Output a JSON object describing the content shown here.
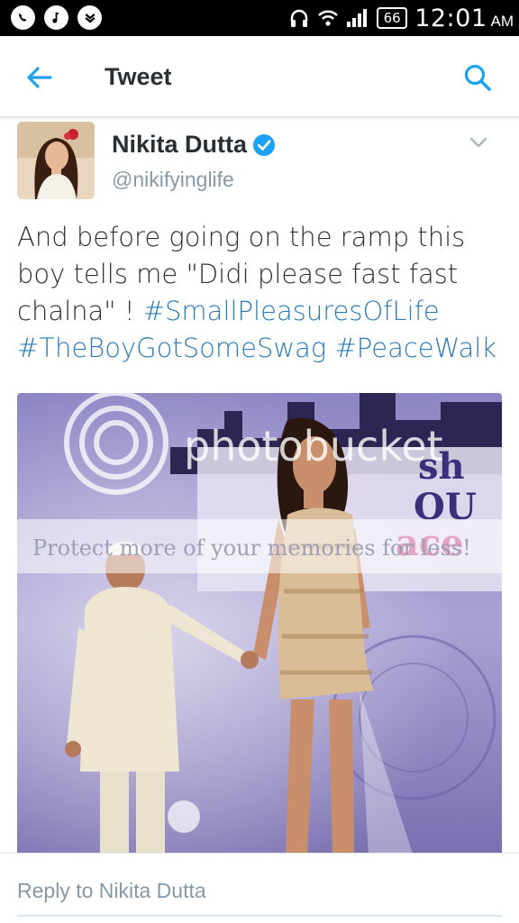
{
  "status_bar": {
    "battery": "66",
    "time": "12:01",
    "ampm": "AM",
    "icons": [
      "whatsapp-icon",
      "music-icon",
      "notification-icon",
      "headphones-icon",
      "wifi-icon",
      "signal-icon",
      "battery-icon"
    ]
  },
  "app_bar": {
    "title": "Tweet",
    "back_icon": "arrow-left-icon",
    "search_icon": "search-icon"
  },
  "tweet": {
    "name": "Nikita Dutta",
    "handle": "@nikifyinglife",
    "verified": true,
    "text_plain": "And before going on the ramp this boy tells me \"Didi please fast fast chalna\" !",
    "hashtags": [
      "#SmallPleasuresOfLife",
      "#TheBoyGotSomeSwag",
      "#PeaceWalk"
    ]
  },
  "photo": {
    "watermark_brand": "photobucket",
    "watermark_tagline": "Protect more of your memories for less!",
    "banner_text": [
      "sh",
      "OU",
      "ace"
    ]
  },
  "reply": {
    "placeholder": "Reply to Nikita Dutta"
  },
  "colors": {
    "accent": "#1da1f2",
    "hashtag": "#2b7bb9",
    "text": "#292f33",
    "muted": "#8899a6"
  }
}
